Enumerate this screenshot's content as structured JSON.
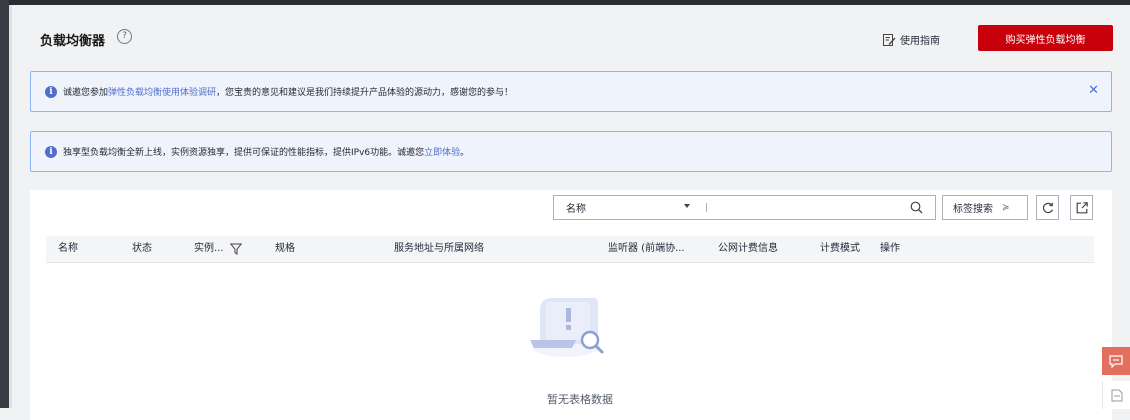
{
  "header": {
    "title": "负载均衡器",
    "help": "?",
    "guide_label": "使用指南",
    "buy_label": "购买弹性负载均衡"
  },
  "notices": [
    {
      "before": "诚邀您参加",
      "link": "弹性负载均衡使用体验调研",
      "after": "，您宝贵的意见和建议是我们持续提升产品体验的源动力，感谢您的参与！",
      "close": "✕"
    },
    {
      "before": "独享型负载均衡全新上线，实例资源独享，提供可保证的性能指标，提供IPv6功能。诚邀您",
      "link": "立即体验",
      "after": "。"
    }
  ],
  "toolbar": {
    "search_field": "名称",
    "search_value": "",
    "tag_search_label": "标签搜索"
  },
  "table": {
    "columns": [
      "名称",
      "状态",
      "实例...",
      "规格",
      "服务地址与所属网络",
      "监听器 (前端协...",
      "公网计费信息",
      "计费模式",
      "操作"
    ],
    "empty_text": "暂无表格数据"
  },
  "colors": {
    "brand": "#c7000b",
    "info": "#526ecc",
    "notice_border": "#8fb4f5",
    "notice_bg": "#eef3fc"
  }
}
